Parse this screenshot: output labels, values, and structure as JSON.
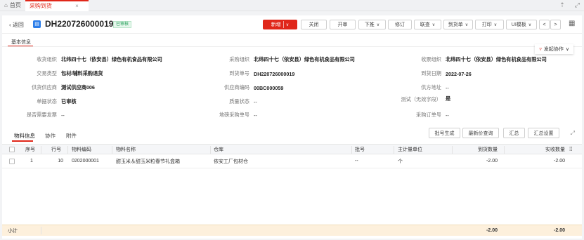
{
  "tabs": {
    "home": "首页",
    "active": "采购到货",
    "close": "×"
  },
  "window_icons": {
    "pin": "⇡",
    "fullscreen": "⤢"
  },
  "header": {
    "back": "返回",
    "doc_number": "DH220726000019",
    "status": "已审核"
  },
  "toolbar": {
    "add": "新增",
    "close": "关闭",
    "open": "开审",
    "push_down": "下推",
    "modify": "修订",
    "link_query": "联查",
    "goto_doc": "到货单",
    "print": "打印",
    "ui_template": "UI模板",
    "prev": "<",
    "next": ">"
  },
  "section_title": "基本信息",
  "collaborate": "发起协作",
  "fields": [
    {
      "label": "收货组织",
      "value": "北纬四十七（依安县）绿色有机食品有限公司"
    },
    {
      "label": "采购组织",
      "value": "北纬四十七（依安县）绿色有机食品有限公司"
    },
    {
      "label": "收票组织",
      "value": "北纬四十七（依安县）绿色有机食品有限公司"
    },
    {
      "label": "交易类型",
      "value": "包材/辅料采购退货"
    },
    {
      "label": "到货单号",
      "value": "DH220726000019"
    },
    {
      "label": "到货日期",
      "value": "2022-07-26"
    },
    {
      "label": "供货供应商",
      "value": "测试供应商006"
    },
    {
      "label": "供应商编码",
      "value": "00BC000059"
    },
    {
      "label": "供方地址",
      "value": "--"
    },
    {
      "label": "单据状态",
      "value": "已审核"
    },
    {
      "label": "质量状态",
      "value": "--"
    },
    {
      "label": "测试（无效字段）",
      "value": "是"
    },
    {
      "label": "是否需要发票",
      "value": "--"
    },
    {
      "label": "地磅采购单号",
      "value": "--"
    },
    {
      "label": "采购订单号",
      "value": "--"
    }
  ],
  "detail_tabs": [
    "物料信息",
    "协作",
    "附件"
  ],
  "table_buttons": {
    "batch_gen": "批号生成",
    "latest_price": "最新价查询",
    "summary": "汇总",
    "summary_settings": "汇总设置"
  },
  "table": {
    "headers": [
      "序号",
      "行号",
      "物料编码",
      "物料名称",
      "仓库",
      "批号",
      "主计量单位",
      "到货数量",
      "实收数量"
    ],
    "rows": [
      [
        "1",
        "10",
        "0202000001",
        "甜玉米＆甜玉米粒春节礼盒箱",
        "依安工厂包材仓",
        "--",
        "个",
        "-2.00",
        "-2.00"
      ]
    ],
    "footer_label": "小计",
    "footer_arrival": "-2.00",
    "footer_received": "-2.00"
  }
}
